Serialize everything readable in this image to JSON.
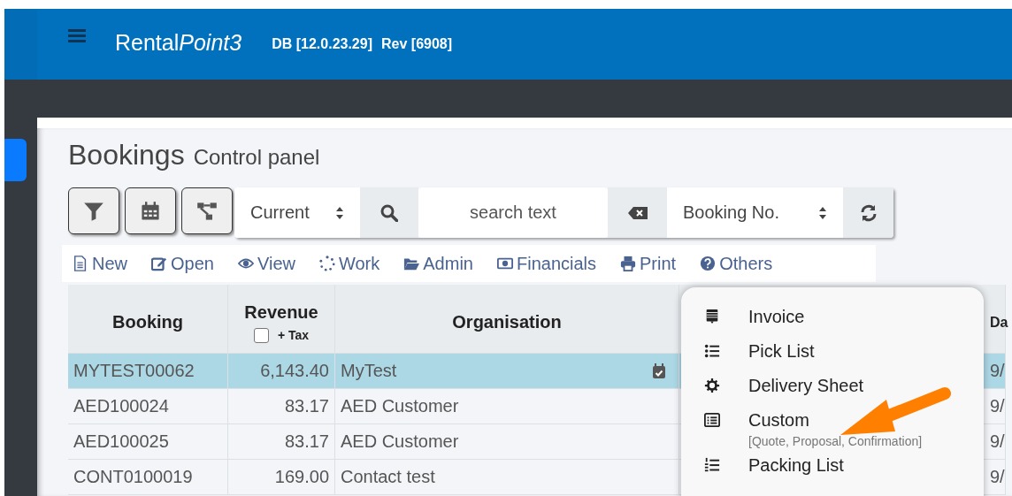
{
  "header": {
    "brand": "Rental",
    "brand_emphasis": "Point3",
    "db": "DB [12.0.23.29]",
    "rev": "Rev [6908]"
  },
  "page": {
    "title": "Bookings",
    "subtitle": "Control panel"
  },
  "toolbar": {
    "filter_select": "Current",
    "search": {
      "placeholder": "search text"
    },
    "sort_select": "Booking No."
  },
  "actions": [
    "New",
    "Open",
    "View",
    "Work",
    "Admin",
    "Financials",
    "Print",
    "Others"
  ],
  "table": {
    "columns": [
      {
        "label": "Booking"
      },
      {
        "label": "Revenue",
        "tax_label": "+ Tax",
        "tax_checked": false
      },
      {
        "label": "Organisation"
      },
      {
        "label": "Da"
      }
    ],
    "rows": [
      {
        "booking": "MYTEST00062",
        "revenue": "6,143.40",
        "organisation": "MyTest",
        "column_4": "9/",
        "selected": true,
        "scheduled": true
      },
      {
        "booking": "AED100024",
        "revenue": "83.17",
        "organisation": "AED Customer",
        "column_4": "9/",
        "selected": false,
        "scheduled": false
      },
      {
        "booking": "AED100025",
        "revenue": "83.17",
        "organisation": "AED Customer",
        "column_4": "9/",
        "selected": false,
        "scheduled": false
      },
      {
        "booking": "CONT0100019",
        "revenue": "169.00",
        "organisation": "Contact test",
        "column_4": "9/",
        "selected": false,
        "scheduled": false
      }
    ]
  },
  "print_menu": [
    {
      "label": "Invoice"
    },
    {
      "label": "Pick List"
    },
    {
      "label": "Delivery Sheet"
    },
    {
      "label": "Custom",
      "note": "[Quote, Proposal, Confirmation]"
    },
    {
      "label": "Packing List"
    }
  ]
}
